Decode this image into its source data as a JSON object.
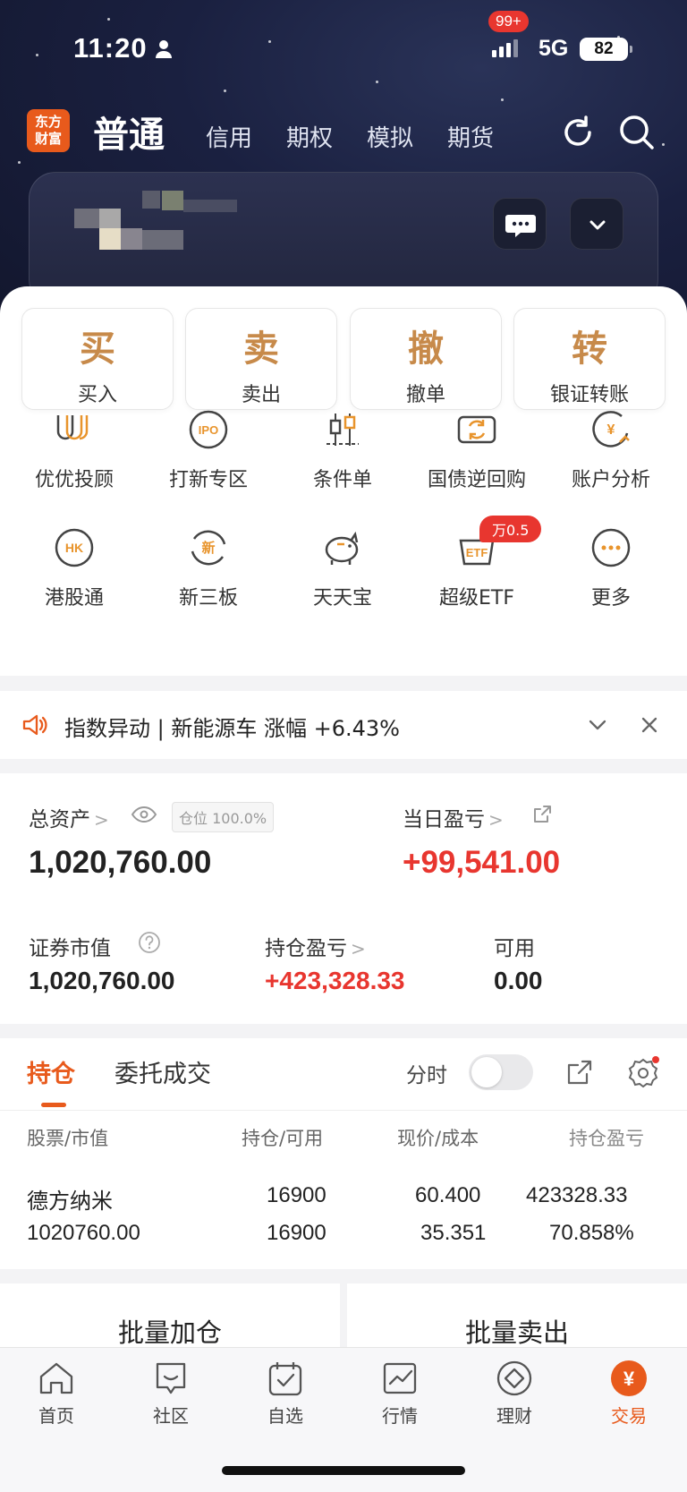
{
  "status_bar": {
    "time": "11:20",
    "network": "5G",
    "battery": "82"
  },
  "top_nav": {
    "logo_line1": "东方",
    "logo_line2": "财富",
    "active_mode": "普通",
    "modes": [
      "信用",
      "期权",
      "模拟",
      "期货"
    ]
  },
  "account": {
    "message_badge": "99+"
  },
  "quick_actions": [
    {
      "glyph": "买",
      "label": "买入"
    },
    {
      "glyph": "卖",
      "label": "卖出"
    },
    {
      "glyph": "撤",
      "label": "撤单"
    },
    {
      "glyph": "转",
      "label": "银证转账"
    }
  ],
  "grid_row1": [
    {
      "label": "优优投顾",
      "icon": "uu-advisor-icon"
    },
    {
      "label": "打新专区",
      "icon": "ipo-icon",
      "icon_text": "IPO"
    },
    {
      "label": "条件单",
      "icon": "condition-order-icon"
    },
    {
      "label": "国债逆回购",
      "icon": "reverse-repo-icon"
    },
    {
      "label": "账户分析",
      "icon": "account-analysis-icon",
      "icon_text": "¥"
    }
  ],
  "grid_row2": [
    {
      "label": "港股通",
      "icon": "hk-connect-icon",
      "icon_text": "HK"
    },
    {
      "label": "新三板",
      "icon": "neeq-icon",
      "icon_text": "新"
    },
    {
      "label": "天天宝",
      "icon": "piggy-bank-icon"
    },
    {
      "label": "超级ETF",
      "icon": "etf-icon",
      "icon_text": "ETF",
      "badge": "万0.5"
    },
    {
      "label": "更多",
      "icon": "more-icon"
    }
  ],
  "notice": {
    "text": "指数异动 | 新能源车 涨幅 +6.43%"
  },
  "assets": {
    "total_label": "总资产",
    "position_ratio": "仓位 100.0%",
    "total_value": "1,020,760.00",
    "daily_pl_label": "当日盈亏",
    "daily_pl_value": "+99,541.00",
    "market_value_label": "证券市值",
    "market_value": "1,020,760.00",
    "holding_pl_label": "持仓盈亏",
    "holding_pl_value": "+423,328.33",
    "available_label": "可用",
    "available_value": "0.00"
  },
  "positions": {
    "tab_holdings": "持仓",
    "tab_orders": "委托成交",
    "intraday_label": "分时",
    "headers": [
      "股票/市值",
      "持仓/可用",
      "现价/成本",
      "持仓盈亏"
    ],
    "rows": [
      {
        "name": "德方纳米",
        "market_value": "1020760.00",
        "holding": "16900",
        "available": "16900",
        "price": "60.400",
        "cost": "35.351",
        "pl": "423328.33",
        "pl_pct": "70.858%"
      }
    ]
  },
  "actions": {
    "batch_add": "批量加仓",
    "batch_sell": "批量卖出"
  },
  "tabbar": [
    {
      "label": "首页",
      "icon": "home-icon"
    },
    {
      "label": "社区",
      "icon": "community-icon"
    },
    {
      "label": "自选",
      "icon": "watchlist-icon"
    },
    {
      "label": "行情",
      "icon": "market-icon"
    },
    {
      "label": "理财",
      "icon": "wealth-icon"
    },
    {
      "label": "交易",
      "icon": "trade-icon",
      "icon_text": "¥"
    }
  ],
  "colors": {
    "brand": "#e85a1c",
    "gain": "#e8362f",
    "gold": "#c78a4a"
  }
}
